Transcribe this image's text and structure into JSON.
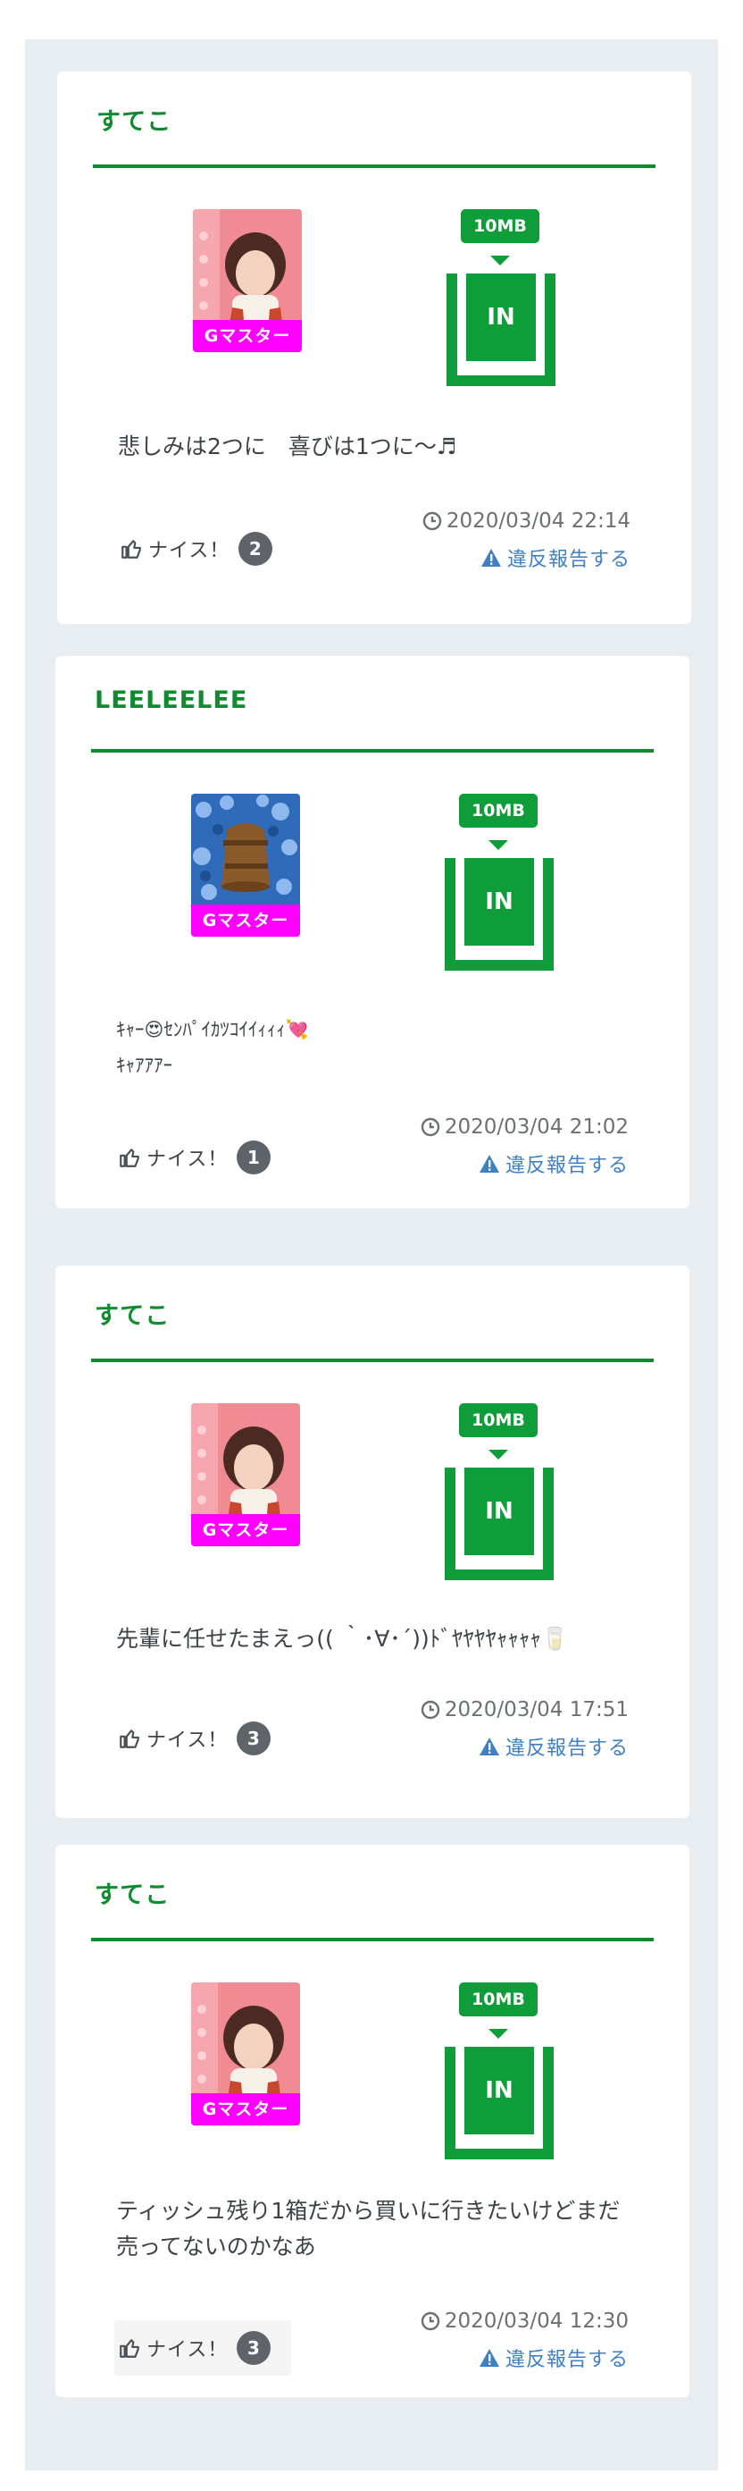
{
  "colors": {
    "accent": "#0f8a2e",
    "in_box": "#0f9d3a",
    "rank_badge": "#ff00ff",
    "link": "#3f7fc4",
    "feed_bg": "#e8edf2"
  },
  "posts": [
    {
      "name": "すてこ",
      "avatar": "girl-portrait",
      "rank": "Gマスター",
      "size": "10MB",
      "in_label": "IN",
      "message": "悲しみは2つに　喜びは1つに〜♬",
      "like_label": "ナイス！",
      "like_count": "2",
      "timestamp": "2020/03/04 22:14",
      "report_label": "違反報告する"
    },
    {
      "name": "LEELEELEE",
      "avatar": "flowers-bell",
      "rank": "Gマスター",
      "size": "10MB",
      "in_label": "IN",
      "message_line1": "ｷｬｰ😍ｾﾝﾊﾟｲｶﾂｺｲｲｨｨｨ💘",
      "message_line2": "ｷｬｱｱｱｰ",
      "like_label": "ナイス！",
      "like_count": "1",
      "timestamp": "2020/03/04 21:02",
      "report_label": "違反報告する"
    },
    {
      "name": "すてこ",
      "avatar": "girl-portrait",
      "rank": "Gマスター",
      "size": "10MB",
      "in_label": "IN",
      "message": "先輩に任せたまえっ(( ｀･∀･´))ﾄﾞﾔﾔﾔﾔｬｬｬｬ🥛",
      "like_label": "ナイス！",
      "like_count": "3",
      "timestamp": "2020/03/04 17:51",
      "report_label": "違反報告する"
    },
    {
      "name": "すてこ",
      "avatar": "girl-portrait",
      "rank": "Gマスター",
      "size": "10MB",
      "in_label": "IN",
      "message": "ティッシュ残り1箱だから買いに行きたいけどまだ売ってないのかなあ",
      "like_label": "ナイス！",
      "like_count": "3",
      "timestamp": "2020/03/04 12:30",
      "report_label": "違反報告する"
    }
  ]
}
